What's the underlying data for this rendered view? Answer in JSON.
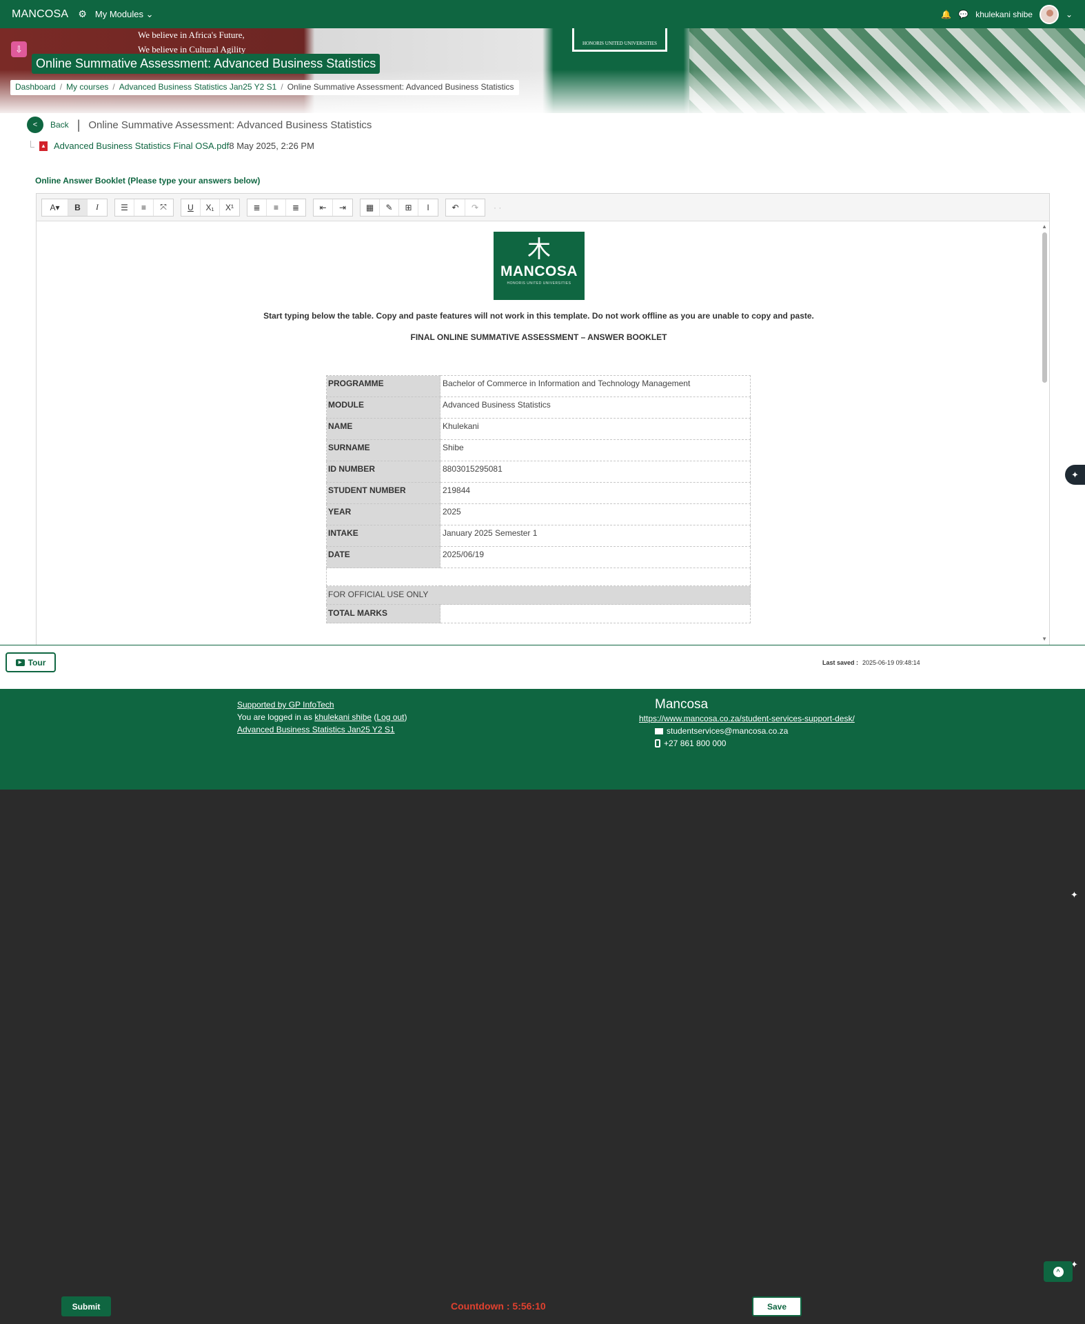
{
  "navbar": {
    "brand": "MANCOSA",
    "modules_label": "My Modules",
    "user_name": "khulekani shibe"
  },
  "banner": {
    "line1": "We believe in Africa's Future,",
    "line2": "We believe in Cultural Agility",
    "sign_text": "HONORIS UNITED UNIVERSITIES"
  },
  "page": {
    "title": "Online Summative Assessment: Advanced Business Statistics"
  },
  "breadcrumb": {
    "items": [
      "Dashboard",
      "My courses",
      "Advanced Business Statistics Jan25 Y2 S1"
    ],
    "current": "Online Summative Assessment: Advanced Business Statistics"
  },
  "back": {
    "label": "Back",
    "title": "Online Summative Assessment: Advanced Business Statistics"
  },
  "file": {
    "name": "Advanced Business Statistics Final OSA.pdf",
    "date": "8 May 2025, 2:26 PM"
  },
  "booklet_label": "Online Answer Booklet (Please type your answers below)",
  "editor": {
    "toolbar_icons": [
      "text-style-icon",
      "bold-icon",
      "italic-icon",
      "bullet-list-icon",
      "numbered-list-icon",
      "fullscreen-icon",
      "underline-icon",
      "subscript-icon",
      "superscript-icon",
      "align-left-icon",
      "align-center-icon",
      "align-right-icon",
      "outdent-icon",
      "indent-icon",
      "calculator-icon",
      "edit-icon",
      "table-icon",
      "text-cursor-icon",
      "undo-icon",
      "redo-icon"
    ],
    "logo": {
      "word": "MANCOSA",
      "sub": "HONORIS UNITED UNIVERSITIES"
    },
    "note": "Start typing below the table. Copy and paste features will not work in this template. Do not work offline as you are unable to copy and paste.",
    "heading": "FINAL ONLINE SUMMATIVE ASSESSMENT – ANSWER BOOKLET",
    "table": [
      {
        "label": "PROGRAMME",
        "value": "Bachelor of Commerce in Information and Technology Management"
      },
      {
        "label": "MODULE",
        "value": "Advanced Business Statistics"
      },
      {
        "label": "NAME",
        "value": "Khulekani"
      },
      {
        "label": "SURNAME",
        "value": "Shibe"
      },
      {
        "label": "ID NUMBER",
        "value": "8803015295081"
      },
      {
        "label": "STUDENT NUMBER",
        "value": "219844"
      },
      {
        "label": "YEAR",
        "value": "2025"
      },
      {
        "label": "INTAKE",
        "value": "January 2025 Semester 1"
      },
      {
        "label": "DATE",
        "value": "2025/06/19"
      }
    ],
    "official_label": "FOR OFFICIAL USE ONLY",
    "total_marks_label": "TOTAL MARKS"
  },
  "tour_label": "Tour",
  "last_saved": {
    "label": "Last saved :",
    "value": "2025-06-19 09:48:14"
  },
  "footer": {
    "supported": "Supported by GP InfoTech",
    "logged_prefix": "You are logged in as",
    "logged_user": "khulekani shibe",
    "logout": "Log out",
    "course_link": "Advanced Business Statistics Jan25 Y2 S1",
    "brand": "Mancosa",
    "support_url": "https://www.mancosa.co.za/student-services-support-desk/",
    "email": "studentservices@mancosa.co.za",
    "phone": "+27 861 800 000"
  },
  "bottom_bar": {
    "submit": "Submit",
    "countdown": "Countdown : 5:56:10",
    "save": "Save"
  },
  "colors": {
    "brand_green": "#0f6641",
    "countdown_red": "#e0412f",
    "dark_background": "#2b2b2b"
  }
}
